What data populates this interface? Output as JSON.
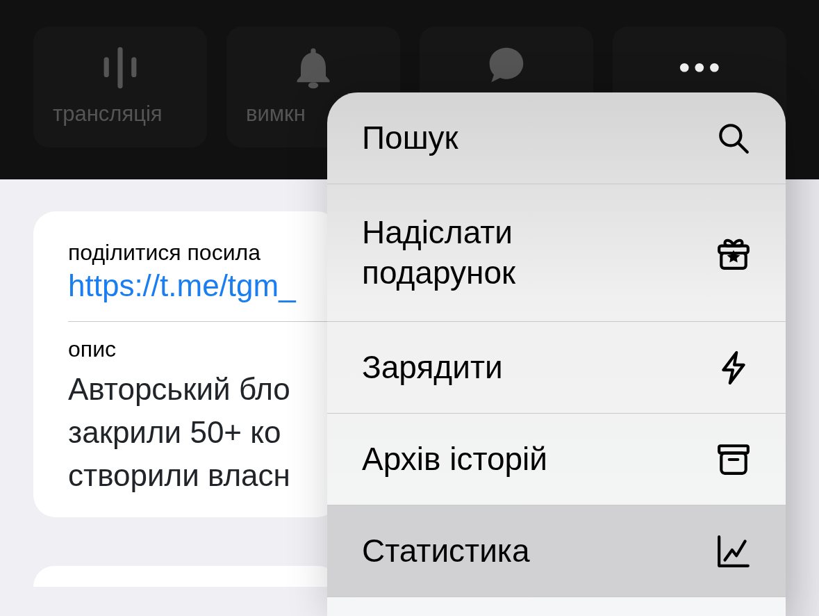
{
  "action_buttons": [
    {
      "kind": "broadcast",
      "label": "трансляція"
    },
    {
      "kind": "bell",
      "label": "вимкн"
    },
    {
      "kind": "comment"
    },
    {
      "kind": "more"
    }
  ],
  "info_card": {
    "rows": [
      {
        "kind": "link",
        "label": "поділитися посила",
        "value": "https://t.me/tgm_"
      },
      {
        "kind": "text",
        "label": "опис",
        "lines": [
          "Авторський бло",
          "закрили 50+ ко",
          "створили власн"
        ]
      }
    ]
  },
  "menu": {
    "items": [
      {
        "kind": "search",
        "label": "Пошук",
        "highlighted": false
      },
      {
        "kind": "gift",
        "label": "Надіслати подарунок",
        "highlighted": false
      },
      {
        "kind": "boost",
        "label": "Зарядити",
        "highlighted": false
      },
      {
        "kind": "archive",
        "label": "Архів історій",
        "highlighted": false
      },
      {
        "kind": "stats",
        "label": "Статистика",
        "highlighted": true
      }
    ]
  }
}
